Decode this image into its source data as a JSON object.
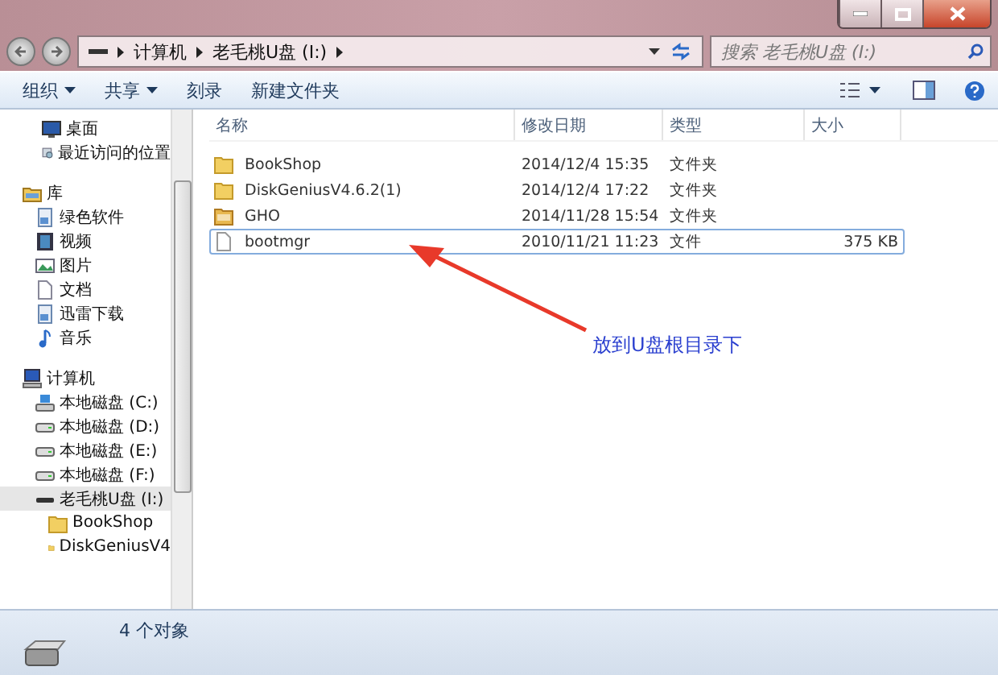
{
  "address": {
    "crumbs": [
      "计算机",
      "老毛桃U盘 (I:)"
    ]
  },
  "search": {
    "placeholder": "搜索 老毛桃U盘 (I:)"
  },
  "toolbar": {
    "buttons": [
      {
        "label": "组织",
        "kind": "menu"
      },
      {
        "label": "共享",
        "kind": "menu"
      },
      {
        "label": "刻录",
        "kind": "plain"
      },
      {
        "label": "新建文件夹",
        "kind": "plain"
      }
    ]
  },
  "favorites": [
    {
      "label": "桌面",
      "kind": "desktop",
      "selected": false
    },
    {
      "label": "最近访问的位置",
      "kind": "recent",
      "selected": false
    }
  ],
  "nav": [
    {
      "label": "库",
      "kind": "library",
      "selected": false,
      "children": [
        {
          "label": "绿色软件",
          "kind": "doclib",
          "selected": false
        },
        {
          "label": "视频",
          "kind": "video",
          "selected": false
        },
        {
          "label": "图片",
          "kind": "picture",
          "selected": false
        },
        {
          "label": "文档",
          "kind": "document",
          "selected": false
        },
        {
          "label": "迅雷下载",
          "kind": "doclib",
          "selected": false
        },
        {
          "label": "音乐",
          "kind": "music",
          "selected": false
        }
      ]
    },
    {
      "label": "计算机",
      "kind": "computer",
      "selected": false,
      "children": [
        {
          "label": "本地磁盘 (C:)",
          "kind": "sysdrive",
          "selected": false
        },
        {
          "label": "本地磁盘 (D:)",
          "kind": "drive",
          "selected": false
        },
        {
          "label": "本地磁盘 (E:)",
          "kind": "drive",
          "selected": false
        },
        {
          "label": "本地磁盘 (F:)",
          "kind": "drive",
          "selected": false
        },
        {
          "label": "老毛桃U盘 (I:)",
          "kind": "usb",
          "selected": true,
          "children": [
            {
              "label": "BookShop",
              "kind": "folder",
              "selected": false
            },
            {
              "label": "DiskGeniusV4",
              "kind": "folder",
              "selected": false
            }
          ]
        }
      ]
    }
  ],
  "columns": [
    "名称",
    "修改日期",
    "类型",
    "大小"
  ],
  "files": [
    {
      "kind": "folder",
      "name": "BookShop",
      "date": "2014/12/4 15:35",
      "type": "文件夹",
      "selected": false
    },
    {
      "kind": "folder",
      "name": "DiskGeniusV4.6.2(1)",
      "date": "2014/12/4 17:22",
      "type": "文件夹",
      "selected": false
    },
    {
      "kind": "ghost",
      "name": "GHO",
      "date": "2014/11/28 15:54",
      "type": "文件夹",
      "selected": false
    },
    {
      "kind": "file",
      "name": "bootmgr",
      "date": "2010/11/21 11:23",
      "type": "文件",
      "size": "375 KB",
      "selected": true
    }
  ],
  "annotation": {
    "text": "放到U盘根目录下"
  },
  "status": {
    "count": "4 个对象"
  }
}
